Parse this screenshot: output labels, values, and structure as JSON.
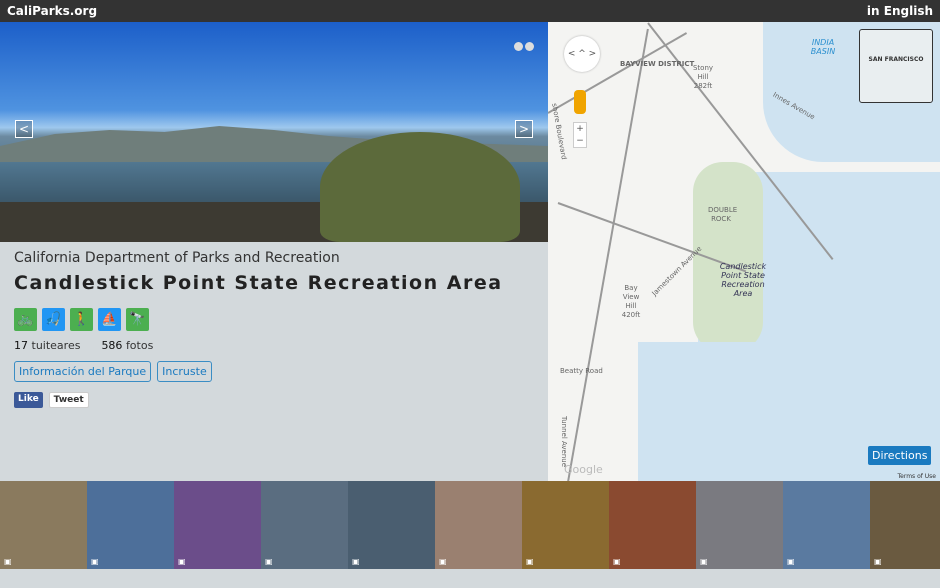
{
  "header": {
    "brand": "CaliParks.org",
    "language": "in English"
  },
  "park": {
    "agency": "California Department of Parks and Recreation",
    "name": "Candlestick Point State Recreation Area",
    "activities": [
      {
        "name": "biking",
        "color": "#4caf50",
        "glyph": "🚲"
      },
      {
        "name": "fishing",
        "color": "#2196f3",
        "glyph": "🎣"
      },
      {
        "name": "hiking",
        "color": "#4caf50",
        "glyph": "🚶"
      },
      {
        "name": "windsurfing",
        "color": "#2196f3",
        "glyph": "⛵"
      },
      {
        "name": "wildlife-viewing",
        "color": "#4caf50",
        "glyph": "🔭"
      }
    ],
    "tweeters_count": "17",
    "tweeters_label": "tuiteares",
    "photos_count": "586",
    "photos_label": "fotos",
    "park_info_button": "Información del Parque",
    "embed_button": "Incruste",
    "like": "Like",
    "tweet": "Tweet"
  },
  "map": {
    "labels": {
      "bayview": "BAYVIEW DISTRICT",
      "stony": "Stony Hill 282ft",
      "india": "INDIA BASIN",
      "innes": "Innes Avenue",
      "double": "DOUBLE ROCK",
      "jamestown": "Jamestown Avenue",
      "bayview_hill": "Bay View Hill 420ft",
      "candlestick": "Candlestick Point State Recreation Area",
      "beatty": "Beatty Road",
      "tunnel": "Tunnel Avenue",
      "shore": "shore Boulevard",
      "inset": "SAN FRANCISCO"
    },
    "directions_button": "Directions",
    "google": "Google",
    "terms": "Terms of Use",
    "zoom_in": "+",
    "zoom_out": "−"
  },
  "photos": [
    {
      "color": "#8a7a5e"
    },
    {
      "color": "#4d6f9a"
    },
    {
      "color": "#6b4d8a"
    },
    {
      "color": "#5a6d80"
    },
    {
      "color": "#4a5e70"
    },
    {
      "color": "#9a8070"
    },
    {
      "color": "#8a6a30"
    },
    {
      "color": "#8a4a30"
    },
    {
      "color": "#7a7a80"
    },
    {
      "color": "#5a7aa0"
    },
    {
      "color": "#6a5a40"
    }
  ]
}
